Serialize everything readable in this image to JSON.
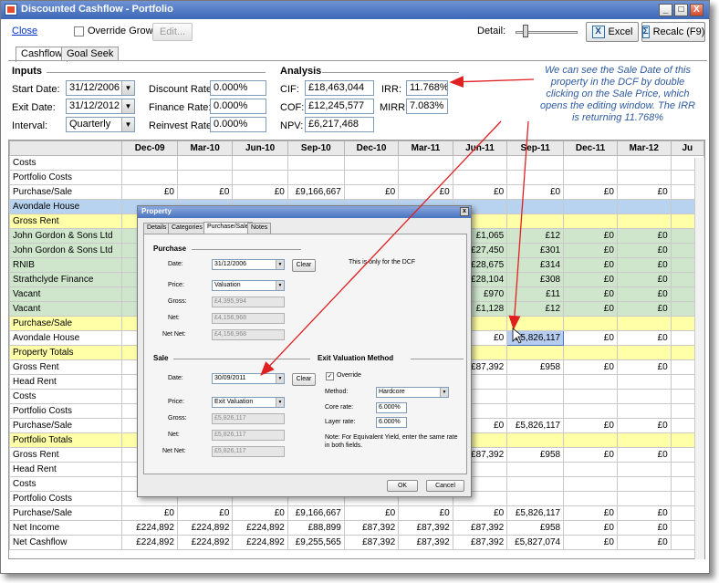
{
  "window": {
    "title": "Discounted Cashflow - Portfolio",
    "min": "_",
    "max": "□",
    "close": "X"
  },
  "toolbar": {
    "close_link": "Close",
    "override_growth": "Override Growth",
    "edit_button": "Edit...",
    "detail_label": "Detail:",
    "excel_button": "Excel",
    "recalc_button": "Recalc (F9)"
  },
  "tabs": [
    "Cashflow",
    "Goal Seek"
  ],
  "inputs": {
    "heading": "Inputs",
    "start_date_label": "Start Date:",
    "start_date": "31/12/2006",
    "exit_date_label": "Exit Date:",
    "exit_date": "31/12/2012",
    "interval_label": "Interval:",
    "interval": "Quarterly",
    "discount_label": "Discount Rate:",
    "discount": "0.000%",
    "finance_label": "Finance Rate:",
    "finance": "0.000%",
    "reinvest_label": "Reinvest Rate:",
    "reinvest": "0.000%"
  },
  "analysis": {
    "heading": "Analysis",
    "cif_label": "CIF:",
    "cif": "£18,463,044",
    "cof_label": "COF:",
    "cof": "£12,245,577",
    "npv_label": "NPV:",
    "npv": "£6,217,468",
    "irr_label": "IRR:",
    "irr": "11.768%",
    "mirr_label": "MIRR:",
    "mirr": "7.083%"
  },
  "note": "We can see the Sale Date of this property in the DCF by double clicking on the Sale Price, which opens the editing window. The IRR is returning 11.768%",
  "grid": {
    "columns": [
      "",
      "Dec-09",
      "Mar-10",
      "Jun-10",
      "Sep-10",
      "Dec-10",
      "Mar-11",
      "Jun-11",
      "Sep-11",
      "Dec-11",
      "Mar-12",
      "Ju"
    ],
    "rows": [
      {
        "style": "",
        "cells": [
          "Costs",
          "",
          "",
          "",
          "",
          "",
          "",
          "",
          "",
          "",
          "",
          ""
        ]
      },
      {
        "style": "",
        "cells": [
          "Portfolio Costs",
          "",
          "",
          "",
          "",
          "",
          "",
          "",
          "",
          "",
          "",
          ""
        ]
      },
      {
        "style": "",
        "cells": [
          "Purchase/Sale",
          "£0",
          "£0",
          "£0",
          "£9,166,667",
          "£0",
          "£0",
          "£0",
          "£0",
          "£0",
          "£0",
          ""
        ]
      },
      {
        "style": "blue",
        "cells": [
          "Avondale House",
          "",
          "",
          "",
          "",
          "",
          "",
          "",
          "",
          "",
          "",
          ""
        ]
      },
      {
        "style": "yellow",
        "cells": [
          "Gross Rent",
          "",
          "",
          "",
          "",
          "",
          "",
          "",
          "",
          "",
          "",
          ""
        ]
      },
      {
        "style": "green",
        "cells": [
          "John Gordon & Sons Ltd",
          "",
          "",
          "",
          "",
          "",
          "",
          "£1,065",
          "£12",
          "£0",
          "£0",
          ""
        ]
      },
      {
        "style": "green",
        "cells": [
          "John Gordon & Sons Ltd",
          "",
          "",
          "",
          "",
          "",
          "",
          "£27,450",
          "£301",
          "£0",
          "£0",
          ""
        ]
      },
      {
        "style": "green",
        "cells": [
          "RNIB",
          "",
          "",
          "",
          "",
          "",
          "",
          "£28,675",
          "£314",
          "£0",
          "£0",
          ""
        ]
      },
      {
        "style": "green",
        "cells": [
          "Strathclyde Finance",
          "",
          "",
          "",
          "",
          "",
          "",
          "£28,104",
          "£308",
          "£0",
          "£0",
          ""
        ]
      },
      {
        "style": "green",
        "cells": [
          "Vacant",
          "",
          "",
          "",
          "",
          "",
          "",
          "£970",
          "£11",
          "£0",
          "£0",
          ""
        ]
      },
      {
        "style": "green",
        "cells": [
          "Vacant",
          "",
          "",
          "",
          "",
          "",
          "",
          "£1,128",
          "£12",
          "£0",
          "£0",
          ""
        ]
      },
      {
        "style": "yellow",
        "cells": [
          "Purchase/Sale",
          "",
          "",
          "",
          "",
          "",
          "",
          "",
          "",
          "",
          "",
          ""
        ]
      },
      {
        "style": "",
        "cells": [
          "Avondale House",
          "",
          "",
          "",
          "",
          "",
          "",
          "£0",
          "£5,826,117",
          "£0",
          "£0",
          ""
        ]
      },
      {
        "style": "yellow",
        "cells": [
          "Property Totals",
          "",
          "",
          "",
          "",
          "",
          "",
          "",
          "",
          "",
          "",
          ""
        ]
      },
      {
        "style": "",
        "cells": [
          "Gross Rent",
          "",
          "",
          "",
          "",
          "",
          "",
          "£87,392",
          "£958",
          "£0",
          "£0",
          ""
        ]
      },
      {
        "style": "",
        "cells": [
          "Head Rent",
          "",
          "",
          "",
          "",
          "",
          "",
          "",
          "",
          "",
          "",
          ""
        ]
      },
      {
        "style": "",
        "cells": [
          "Costs",
          "",
          "",
          "",
          "",
          "",
          "",
          "",
          "",
          "",
          "",
          ""
        ]
      },
      {
        "style": "",
        "cells": [
          "Portfolio Costs",
          "",
          "",
          "",
          "",
          "",
          "",
          "",
          "",
          "",
          "",
          ""
        ]
      },
      {
        "style": "",
        "cells": [
          "Purchase/Sale",
          "",
          "",
          "",
          "",
          "",
          "",
          "£0",
          "£5,826,117",
          "£0",
          "£0",
          ""
        ]
      },
      {
        "style": "yellow",
        "cells": [
          "Portfolio Totals",
          "",
          "",
          "",
          "",
          "",
          "",
          "",
          "",
          "",
          "",
          ""
        ]
      },
      {
        "style": "",
        "cells": [
          "Gross Rent",
          "",
          "",
          "",
          "",
          "",
          "",
          "£87,392",
          "£958",
          "£0",
          "£0",
          ""
        ]
      },
      {
        "style": "",
        "cells": [
          "Head Rent",
          "",
          "",
          "",
          "",
          "",
          "",
          "",
          "",
          "",
          "",
          ""
        ]
      },
      {
        "style": "",
        "cells": [
          "Costs",
          "",
          "",
          "",
          "",
          "",
          "",
          "",
          "",
          "",
          "",
          ""
        ]
      },
      {
        "style": "",
        "cells": [
          "Portfolio Costs",
          "",
          "",
          "",
          "",
          "",
          "",
          "",
          "",
          "",
          "",
          ""
        ]
      },
      {
        "style": "",
        "cells": [
          "Purchase/Sale",
          "£0",
          "£0",
          "£0",
          "£9,166,667",
          "£0",
          "£0",
          "£0",
          "£5,826,117",
          "£0",
          "£0",
          ""
        ]
      },
      {
        "style": "",
        "cells": [
          "Net Income",
          "£224,892",
          "£224,892",
          "£224,892",
          "£88,899",
          "£87,392",
          "£87,392",
          "£87,392",
          "£958",
          "£0",
          "£0",
          ""
        ]
      },
      {
        "style": "",
        "cells": [
          "Net Cashflow",
          "£224,892",
          "£224,892",
          "£224,892",
          "£9,255,565",
          "£87,392",
          "£87,392",
          "£87,392",
          "£5,827,074",
          "£0",
          "£0",
          ""
        ]
      }
    ]
  },
  "dialog": {
    "title": "Property",
    "close": "x",
    "tabs": [
      "Details",
      "Categories",
      "Purchase/Sale",
      "Notes"
    ],
    "purchase": {
      "heading": "Purchase",
      "date_label": "Date:",
      "date": "31/12/2006",
      "clear": "Clear",
      "note": "This is only for the DCF",
      "price_label": "Price:",
      "price": "Valuation",
      "gross_label": "Gross:",
      "gross": "£4,395,994",
      "net_label": "Net:",
      "net": "£4,156,968",
      "netnet_label": "Net Net:",
      "netnet": "£4,156,968"
    },
    "sale": {
      "heading": "Sale",
      "date_label": "Date:",
      "date": "30/09/2011",
      "clear": "Clear",
      "price_label": "Price:",
      "price": "Exit Valuation",
      "gross_label": "Gross:",
      "gross": "£5,826,117",
      "net_label": "Net:",
      "net": "£5,826,117",
      "netnet_label": "Net Net:",
      "netnet": "£5,826,117"
    },
    "exit": {
      "heading": "Exit Valuation Method",
      "override": "Override",
      "method_label": "Method:",
      "method": "Hardcore",
      "core_label": "Core rate:",
      "core": "6.000%",
      "layer_label": "Layer rate:",
      "layer": "6.000%",
      "note": "Note: For Equivalent Yield, enter the same rate in both fields."
    },
    "ok": "OK",
    "cancel": "Cancel"
  },
  "colors": {
    "arrow": "#e02020",
    "green_row": "#cfe6cd",
    "yellow_row": "#ffffa8",
    "blue_row": "#b8d3f0"
  }
}
